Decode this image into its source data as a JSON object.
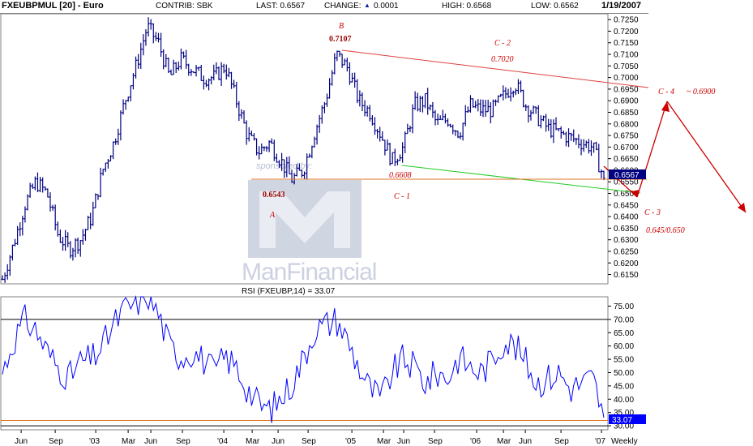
{
  "header": {
    "symbol": "FXEUBPMUL [20] - Euro",
    "contrib": "CONTRIB: SBK",
    "last": "LAST: 0.6567",
    "change_label": "CHANGE:",
    "change_value": "0.0001",
    "high": "HIGH: 0.6568",
    "low": "LOW: 0.6562",
    "date": "1/19/2007"
  },
  "watermark": {
    "sponsored": "sponsored by:",
    "brand": "ManFinancial"
  },
  "rsi_title": "RSI (FXEUBP,14) = 33.07",
  "last_price_box": "0.6567",
  "last_rsi_box": "33.07",
  "colors": {
    "price": "#000080",
    "rsi": "#0000ff",
    "upper_channel": "#e04040",
    "lower_channel": "#22cc22",
    "support": "#e07020",
    "annotation": "#cc0000"
  },
  "annotations": {
    "B": "B",
    "B_val": "0.7107",
    "A": "A",
    "A_val": "0.6543",
    "C2": "C - 2",
    "C2_val": "0.7020",
    "C1": "C - 1",
    "C1_val": "0.6608",
    "C4": "C - 4",
    "C4_val": "~ 0.6900",
    "C3": "C - 3",
    "C3_val": "0.645/0.650"
  },
  "chart_data": [
    {
      "type": "ohlc",
      "title": "FXEUBPMUL [20] - Euro",
      "frequency": "Weekly",
      "ylim": [
        0.611,
        0.7275
      ],
      "y_ticks": [
        "0.7250",
        "0.7200",
        "0.7150",
        "0.7100",
        "0.7050",
        "0.7000",
        "0.6950",
        "0.6900",
        "0.6850",
        "0.6800",
        "0.6750",
        "0.6700",
        "0.6650",
        "0.6600",
        "0.6550",
        "0.6500",
        "0.6450",
        "0.6400",
        "0.6350",
        "0.6300",
        "0.6250",
        "0.6200",
        "0.6150"
      ],
      "x_ticks": [
        "Jun",
        "Sep",
        "'03",
        "Mar",
        "Jun",
        "Sep",
        "'04",
        "Mar",
        "Jun",
        "Sep",
        "'05",
        "Mar",
        "Jun",
        "Sep",
        "'06",
        "Mar",
        "Jun",
        "Sep",
        "'07",
        "Weekly"
      ],
      "x": [
        "2002-06",
        "2002-09",
        "2003-01",
        "2003-03",
        "2003-06",
        "2003-09",
        "2004-01",
        "2004-03",
        "2004-06",
        "2004-09",
        "2005-01",
        "2005-03",
        "2005-06",
        "2005-09",
        "2006-01",
        "2006-03",
        "2006-06",
        "2006-09",
        "2007-01"
      ],
      "close_profile": [
        0.613,
        0.628,
        0.645,
        0.655,
        0.65,
        0.632,
        0.626,
        0.63,
        0.64,
        0.66,
        0.672,
        0.69,
        0.705,
        0.722,
        0.715,
        0.7,
        0.708,
        0.704,
        0.7,
        0.7,
        0.705,
        0.69,
        0.675,
        0.668,
        0.672,
        0.664,
        0.656,
        0.66,
        0.676,
        0.69,
        0.71,
        0.704,
        0.69,
        0.685,
        0.675,
        0.664,
        0.67,
        0.688,
        0.69,
        0.68,
        0.682,
        0.676,
        0.688,
        0.686,
        0.686,
        0.692,
        0.698,
        0.688,
        0.683,
        0.678,
        0.676,
        0.674,
        0.672,
        0.67,
        0.6567
      ],
      "last": 0.6567,
      "key_levels": {
        "A": 0.6543,
        "B": 0.7107,
        "C-1": 0.6608,
        "C-2": 0.702,
        "C-4": 0.69
      },
      "trendlines": {
        "upper": [
          [
            "2004-12",
            0.7107
          ],
          [
            "2007-01",
            0.6955
          ]
        ],
        "lower": [
          [
            "2005-07",
            0.6608
          ],
          [
            "2007-01",
            0.6475
          ]
        ],
        "support": 0.6543
      }
    },
    {
      "type": "line",
      "title": "RSI (FXEUBP,14) = 33.07",
      "ylim": [
        28.5,
        78.5
      ],
      "y_ticks": [
        "75.00",
        "70.00",
        "65.00",
        "60.00",
        "55.00",
        "50.00",
        "45.00",
        "40.00",
        "35.00",
        "30.00"
      ],
      "reference_lines": [
        70,
        30,
        32
      ],
      "profile": [
        50,
        62,
        70,
        66,
        58,
        52,
        48,
        54,
        55,
        60,
        68,
        74,
        76,
        80,
        72,
        60,
        56,
        58,
        55,
        50,
        56,
        52,
        44,
        38,
        36,
        40,
        46,
        55,
        66,
        68,
        70,
        62,
        52,
        44,
        40,
        50,
        55,
        52,
        46,
        50,
        48,
        56,
        52,
        50,
        55,
        62,
        60,
        54,
        46,
        48,
        50,
        44,
        46,
        48,
        33.07
      ],
      "last": 33.07
    }
  ]
}
